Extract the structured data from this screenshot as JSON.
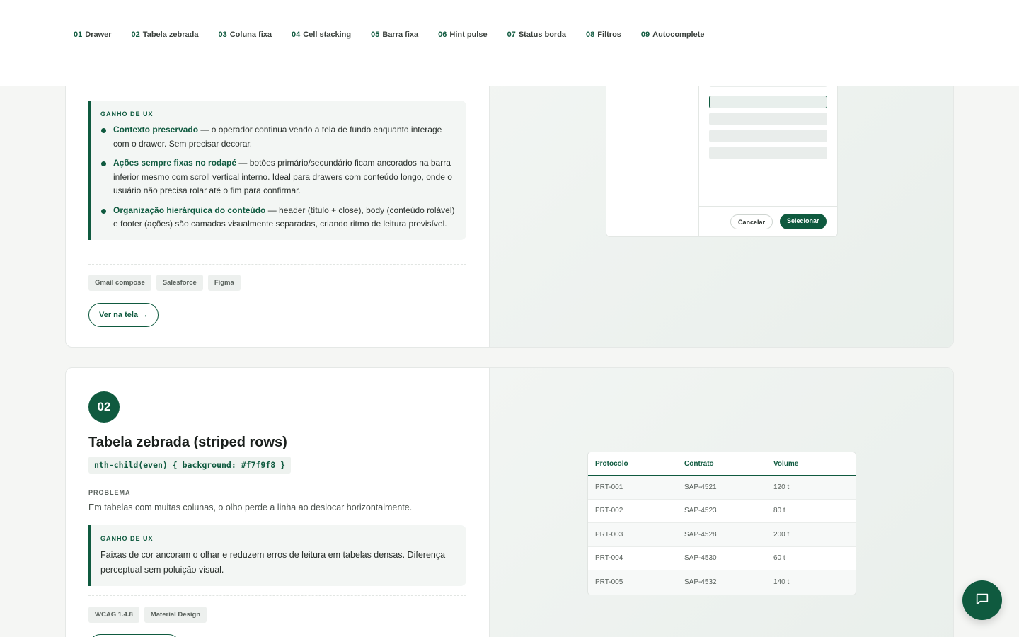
{
  "nav": [
    {
      "num": "01",
      "label": "Drawer"
    },
    {
      "num": "02",
      "label": "Tabela zebrada"
    },
    {
      "num": "03",
      "label": "Coluna fixa"
    },
    {
      "num": "04",
      "label": "Cell stacking"
    },
    {
      "num": "05",
      "label": "Barra fixa"
    },
    {
      "num": "06",
      "label": "Hint pulse"
    },
    {
      "num": "07",
      "label": "Status borda"
    },
    {
      "num": "08",
      "label": "Filtros"
    },
    {
      "num": "09",
      "label": "Autocomplete"
    }
  ],
  "card1": {
    "ux_kicker": "GANHO DE UX",
    "bullets": [
      {
        "strong": "Contexto preservado",
        "text": " — o operador continua vendo a tela de fundo enquanto interage com o drawer. Sem precisar decorar."
      },
      {
        "strong": "Ações sempre fixas no rodapé",
        "text": " — botões primário/secundário ficam ancorados na barra inferior mesmo com scroll vertical interno. Ideal para drawers com conteúdo longo, onde o usuário não precisa rolar até o fim para confirmar."
      },
      {
        "strong": "Organização hierárquica do conteúdo",
        "text": " — header (título + close), body (conteúdo rolável) e footer (ações) são camadas visualmente separadas, criando ritmo de leitura previsível."
      }
    ],
    "tags": [
      "Gmail compose",
      "Salesforce",
      "Figma"
    ],
    "cta": "Ver na tela →",
    "mock": {
      "cancel": "Cancelar",
      "select": "Selecionar"
    }
  },
  "card2": {
    "num": "02",
    "title": "Tabela zebrada (striped rows)",
    "code": "nth-child(even) { background: #f7f9f8 }",
    "problem_label": "PROBLEMA",
    "problem": "Em tabelas com muitas colunas, o olho perde a linha ao deslocar horizontalmente.",
    "ux_kicker": "GANHO DE UX",
    "ux_text": "Faixas de cor ancoram o olhar e reduzem erros de leitura em tabelas densas. Diferença perceptual sem poluição visual.",
    "tags": [
      "WCAG 1.4.8",
      "Material Design"
    ],
    "table": {
      "headers": [
        "Protocolo",
        "Contrato",
        "Volume"
      ],
      "rows": [
        [
          "PRT-001",
          "SAP-4521",
          "120 t"
        ],
        [
          "PRT-002",
          "SAP-4523",
          "80 t"
        ],
        [
          "PRT-003",
          "SAP-4528",
          "200 t"
        ],
        [
          "PRT-004",
          "SAP-4530",
          "60 t"
        ],
        [
          "PRT-005",
          "SAP-4532",
          "140 t"
        ]
      ]
    }
  },
  "colors": {
    "accent": "#0f5a3f",
    "stripe": "#f7f9f8",
    "background": "#f5f6f4"
  },
  "fab_icon": "chat-bubble-icon"
}
